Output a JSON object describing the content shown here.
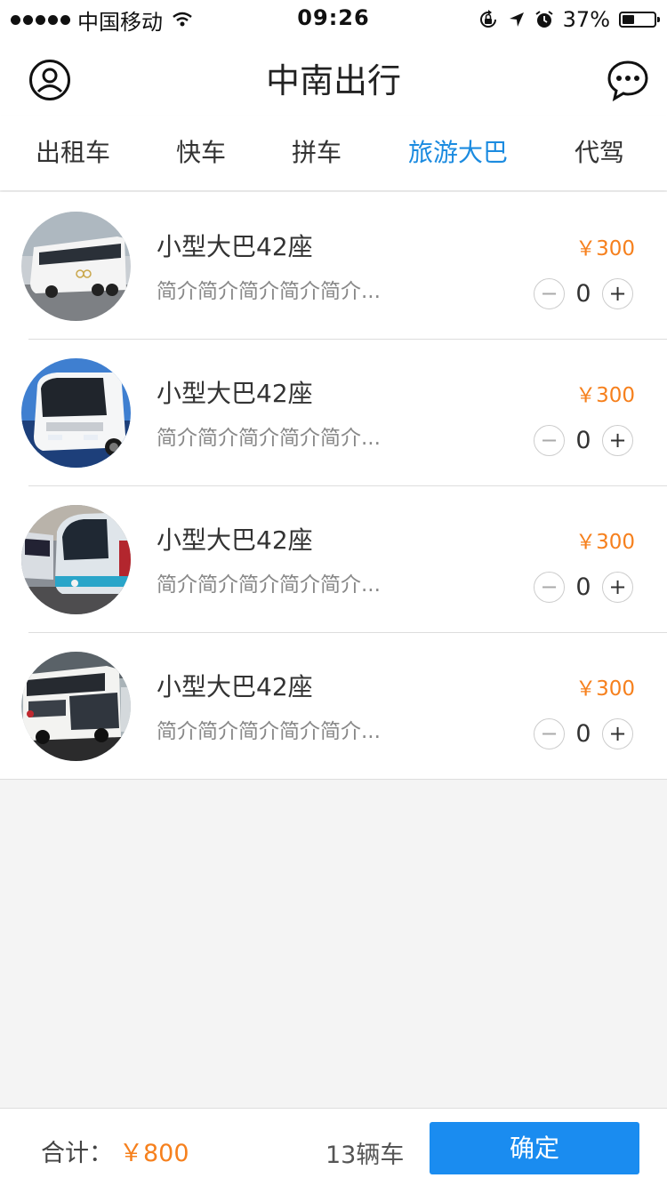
{
  "status_bar": {
    "carrier": "中国移动",
    "time": "09:26",
    "battery_text": "37%",
    "battery_level": 0.37
  },
  "header": {
    "title": "中南出行"
  },
  "tabs": [
    {
      "label": "出租车",
      "active": false
    },
    {
      "label": "快车",
      "active": false
    },
    {
      "label": "拼车",
      "active": false
    },
    {
      "label": "旅游大巴",
      "active": true
    },
    {
      "label": "代驾",
      "active": false
    }
  ],
  "items": [
    {
      "name": "小型大巴42座",
      "desc": "简介简介简介简介简介...",
      "price": "￥300",
      "quantity": "0",
      "image": "white-coach-side-view"
    },
    {
      "name": "小型大巴42座",
      "desc": "简介简介简介简介简介...",
      "price": "￥300",
      "quantity": "0",
      "image": "white-coach-front-view"
    },
    {
      "name": "小型大巴42座",
      "desc": "简介简介简介简介简介...",
      "price": "￥300",
      "quantity": "0",
      "image": "parked-coaches"
    },
    {
      "name": "小型大巴42座",
      "desc": "简介简介简介简介简介...",
      "price": "￥300",
      "quantity": "0",
      "image": "double-deck-coach"
    }
  ],
  "stepper_icons": {
    "minus": "−",
    "plus": "+"
  },
  "footer": {
    "total_label": "合计：",
    "total_value": "￥800",
    "car_count": "13辆车",
    "confirm_label": "确定"
  },
  "colors": {
    "accent_blue": "#1b8be0",
    "price_orange": "#f6801d",
    "button_blue": "#1a8cf0",
    "background": "#f4f4f4"
  }
}
